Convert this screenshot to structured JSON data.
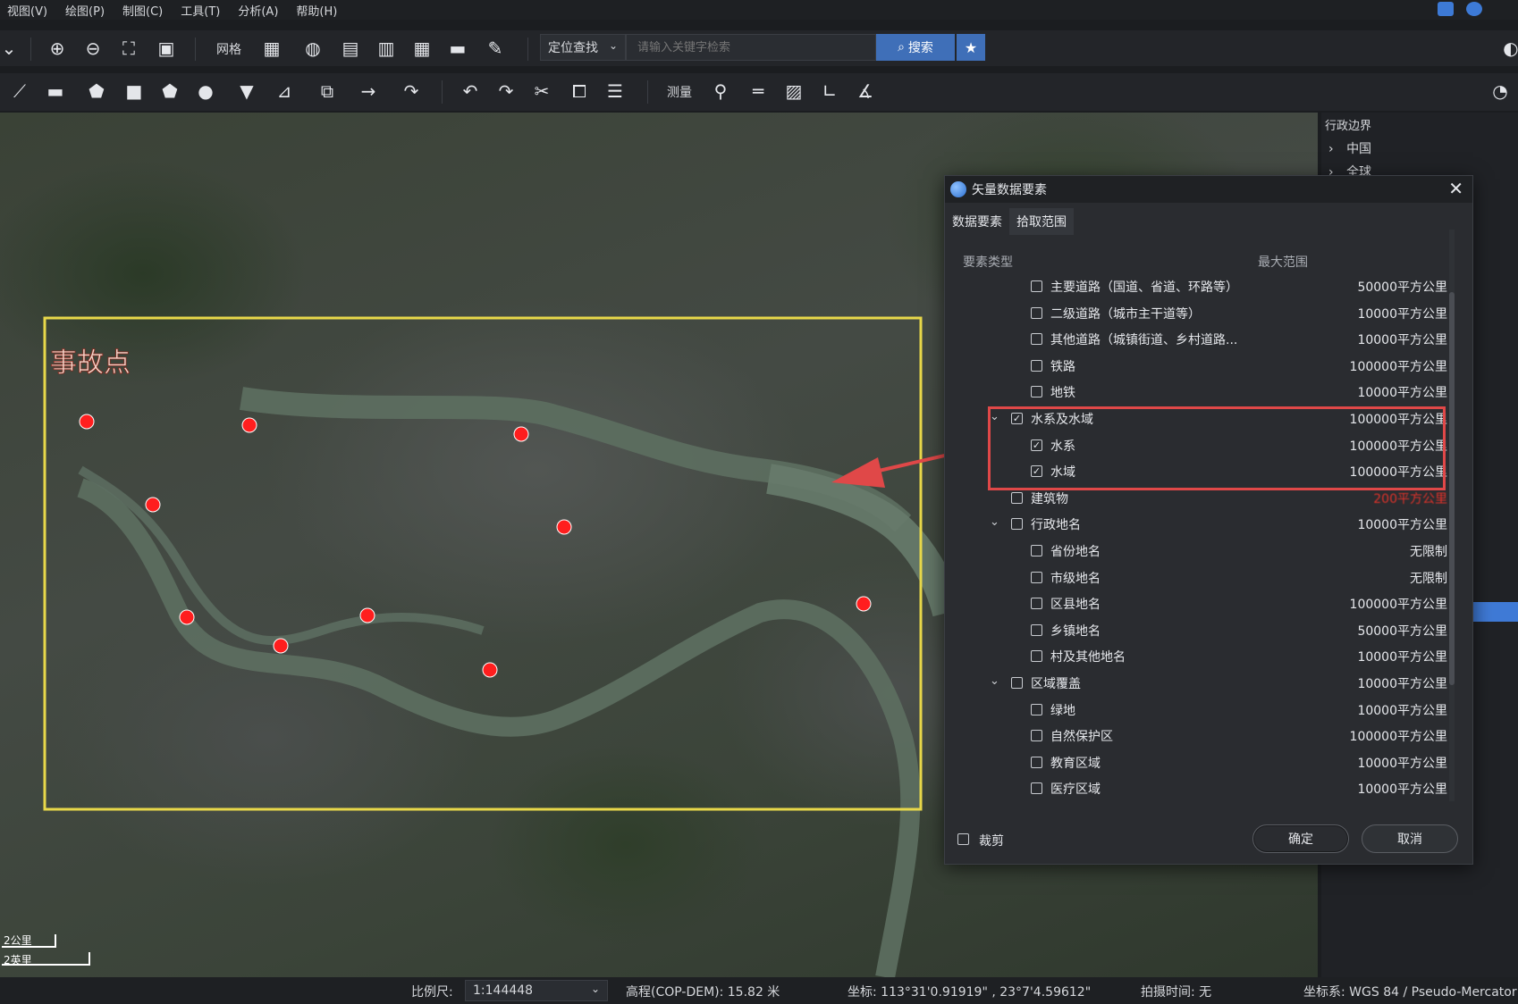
{
  "menubar": {
    "items": [
      "视图(V)",
      "绘图(P)",
      "制图(C)",
      "工具(T)",
      "分析(A)",
      "帮助(H)"
    ]
  },
  "toolbar1": {
    "grid_label": "网格",
    "locate_label": "定位查找",
    "search_placeholder": "请输入关键字检索",
    "search_button": "搜索"
  },
  "toolbar2": {
    "measure_label": "测量"
  },
  "map": {
    "annotation": "事故点",
    "scale_km": "2公里",
    "scale_mi": "2英里",
    "accident_points_count": 11,
    "colors": {
      "selection_box": "#e8d84a",
      "points": "#ff1e1e",
      "arrow": "#e04848"
    }
  },
  "right_panel": {
    "title": "行政边界",
    "items": [
      "中国",
      "全球"
    ]
  },
  "dialog": {
    "title": "矢量数据要素",
    "tabs": [
      "数据要素",
      "拾取范围"
    ],
    "columns": {
      "type": "要素类型",
      "range": "最大范围"
    },
    "rows": [
      {
        "label": "主要道路（国道、省道、环路等）",
        "range": "50000平方公里",
        "level": 2,
        "checked": false
      },
      {
        "label": "二级道路（城市主干道等）",
        "range": "10000平方公里",
        "level": 2,
        "checked": false
      },
      {
        "label": "其他道路（城镇街道、乡村道路...",
        "range": "10000平方公里",
        "level": 2,
        "checked": false
      },
      {
        "label": "铁路",
        "range": "100000平方公里",
        "level": 2,
        "checked": false
      },
      {
        "label": "地铁",
        "range": "10000平方公里",
        "level": 2,
        "checked": false
      },
      {
        "label": "水系及水域",
        "range": "100000平方公里",
        "level": 1,
        "checked": true,
        "expandable": true
      },
      {
        "label": "水系",
        "range": "100000平方公里",
        "level": 2,
        "checked": true
      },
      {
        "label": "水域",
        "range": "100000平方公里",
        "level": 2,
        "checked": true
      },
      {
        "label": "建筑物",
        "range": "200平方公里",
        "level": 1,
        "checked": false,
        "red": true
      },
      {
        "label": "行政地名",
        "range": "10000平方公里",
        "level": 1,
        "checked": false,
        "expandable": true
      },
      {
        "label": "省份地名",
        "range": "无限制",
        "level": 2,
        "checked": false
      },
      {
        "label": "市级地名",
        "range": "无限制",
        "level": 2,
        "checked": false
      },
      {
        "label": "区县地名",
        "range": "100000平方公里",
        "level": 2,
        "checked": false
      },
      {
        "label": "乡镇地名",
        "range": "50000平方公里",
        "level": 2,
        "checked": false
      },
      {
        "label": "村及其他地名",
        "range": "10000平方公里",
        "level": 2,
        "checked": false
      },
      {
        "label": "区域覆盖",
        "range": "10000平方公里",
        "level": 1,
        "checked": false,
        "expandable": true
      },
      {
        "label": "绿地",
        "range": "10000平方公里",
        "level": 2,
        "checked": false
      },
      {
        "label": "自然保护区",
        "range": "100000平方公里",
        "level": 2,
        "checked": false
      },
      {
        "label": "教育区域",
        "range": "10000平方公里",
        "level": 2,
        "checked": false
      },
      {
        "label": "医疗区域",
        "range": "10000平方公里",
        "level": 2,
        "checked": false
      }
    ],
    "clip_label": "裁剪",
    "ok_label": "确定",
    "cancel_label": "取消"
  },
  "statusbar": {
    "scale_label": "比例尺:",
    "scale_value": "1:144448",
    "elevation": "高程(COP-DEM): 15.82 米",
    "coords": "坐标: 113°31'0.91919\" , 23°7'4.59612\"",
    "capture_time": "拍摄时间: 无",
    "crs": "坐标系: WGS 84 / Pseudo-Mercator"
  }
}
